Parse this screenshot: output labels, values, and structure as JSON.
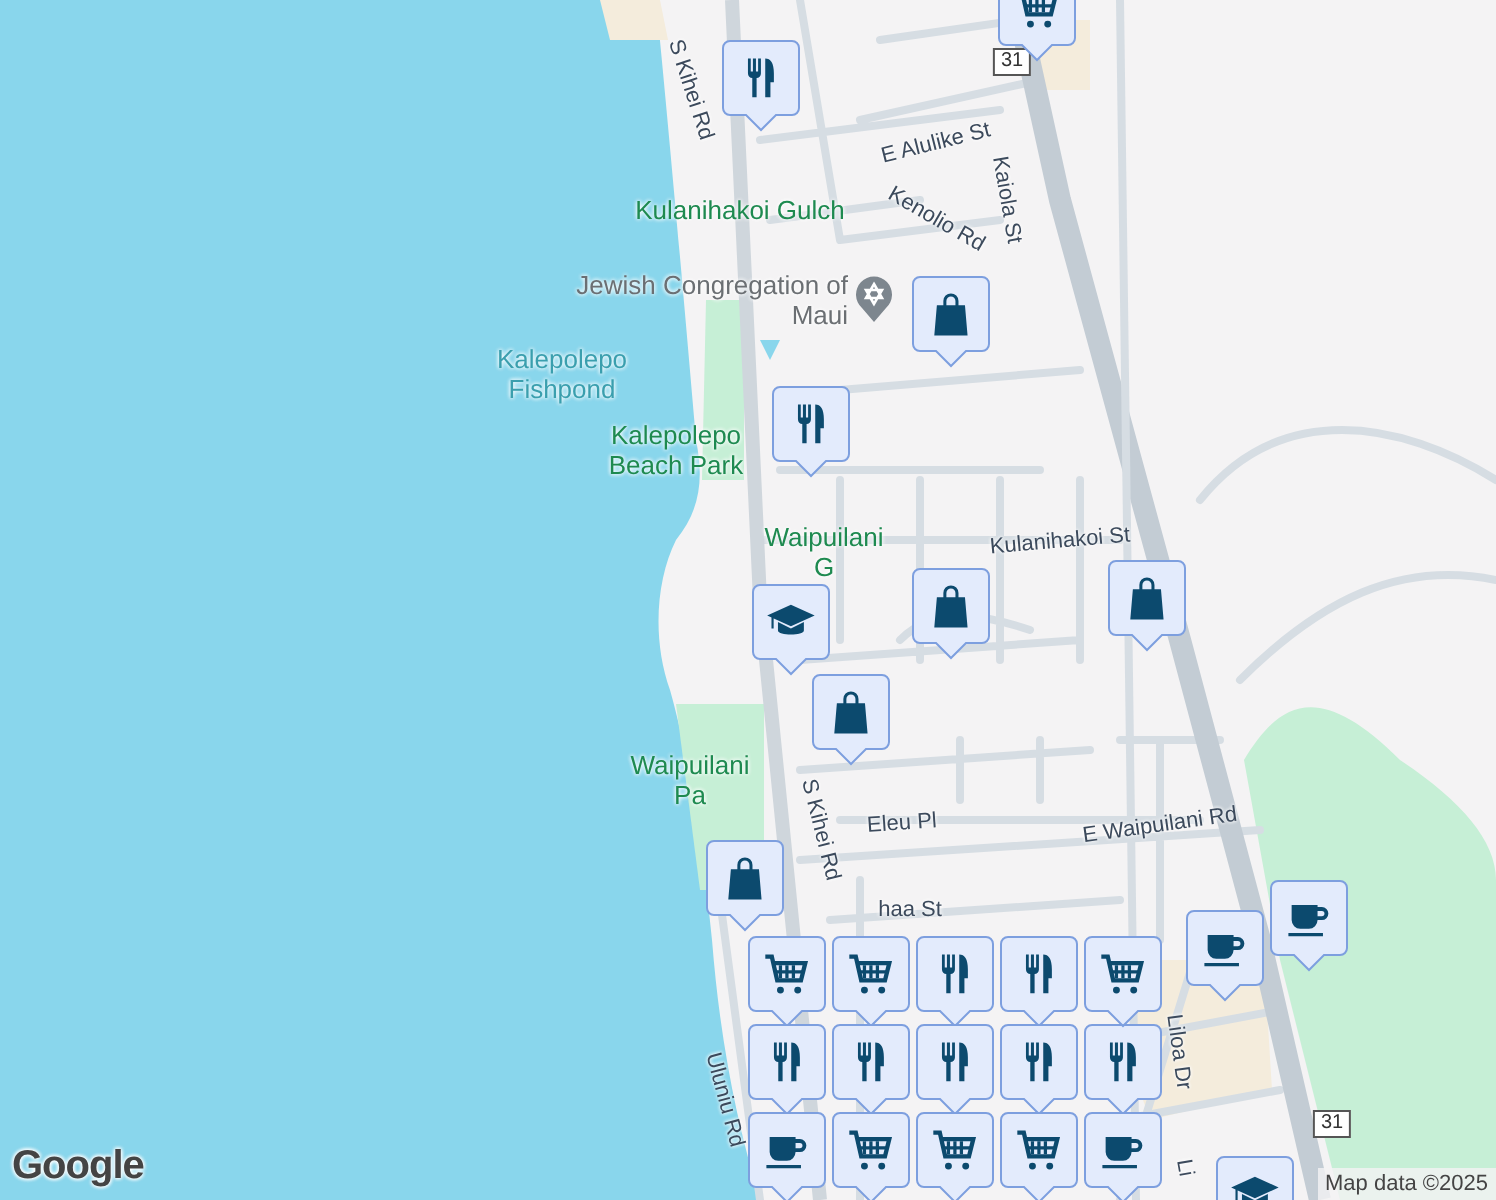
{
  "map": {
    "labels": [
      {
        "text": "S Kihei Rd",
        "kind": "street"
      },
      {
        "text": "E Alulike St",
        "kind": "street"
      },
      {
        "text": "Kenolio Rd",
        "kind": "street"
      },
      {
        "text": "Kaiola St",
        "kind": "street"
      },
      {
        "text": "Kulanihakoi Gulch",
        "kind": "park"
      },
      {
        "text": "Jewish Congregation of Maui",
        "kind": "place"
      },
      {
        "text": "Kalepolepo Fishpond",
        "kind": "water"
      },
      {
        "text": "Kalepolepo Beach Park",
        "kind": "park"
      },
      {
        "text": "Waipuilani G",
        "kind": "park"
      },
      {
        "text": "Kulanihakoi St",
        "kind": "street"
      },
      {
        "text": "S Kihei Rd",
        "kind": "street"
      },
      {
        "text": "Waipuilani Pa",
        "kind": "park"
      },
      {
        "text": "Eleu Pl",
        "kind": "street"
      },
      {
        "text": "E Waipuilani Rd",
        "kind": "street"
      },
      {
        "text": "haa St",
        "kind": "street"
      },
      {
        "text": "Liloa Dr",
        "kind": "street"
      },
      {
        "text": "Uluniu Rd",
        "kind": "street"
      },
      {
        "text": "Li",
        "kind": "street"
      }
    ],
    "route_shields": [
      "31",
      "31"
    ],
    "pins": [
      {
        "kind": "grocery"
      },
      {
        "kind": "restaurant"
      },
      {
        "kind": "shopping"
      },
      {
        "kind": "restaurant"
      },
      {
        "kind": "shopping"
      },
      {
        "kind": "school"
      },
      {
        "kind": "shopping"
      },
      {
        "kind": "shopping"
      },
      {
        "kind": "shopping"
      },
      {
        "kind": "grocery"
      },
      {
        "kind": "cafe"
      },
      {
        "kind": "cafe"
      },
      {
        "kind": "grocery"
      },
      {
        "kind": "restaurant"
      },
      {
        "kind": "restaurant"
      },
      {
        "kind": "restaurant"
      },
      {
        "kind": "restaurant"
      },
      {
        "kind": "restaurant"
      },
      {
        "kind": "restaurant"
      },
      {
        "kind": "restaurant"
      },
      {
        "kind": "cafe"
      },
      {
        "kind": "grocery"
      },
      {
        "kind": "grocery"
      },
      {
        "kind": "grocery"
      },
      {
        "kind": "cafe"
      },
      {
        "kind": "grocery"
      },
      {
        "kind": "school"
      }
    ],
    "logo": "Google",
    "attribution": "Map data ©2025"
  }
}
